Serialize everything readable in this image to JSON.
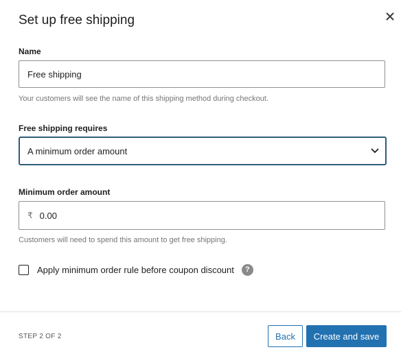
{
  "modal": {
    "title": "Set up free shipping",
    "close_icon": "close-icon"
  },
  "name_field": {
    "label": "Name",
    "value": "Free shipping",
    "help": "Your customers will see the name of this shipping method during checkout."
  },
  "requires_field": {
    "label": "Free shipping requires",
    "selected": "A minimum order amount",
    "icon": "chevron-down-icon"
  },
  "min_amount_field": {
    "label": "Minimum order amount",
    "currency_symbol": "₹",
    "value": "0.00",
    "help": "Customers will need to spend this amount to get free shipping."
  },
  "coupon_rule": {
    "label": "Apply minimum order rule before coupon discount",
    "checked": false,
    "help_icon": "help-icon",
    "help_glyph": "?"
  },
  "footer": {
    "step": "STEP 2 OF 2",
    "back_label": "Back",
    "primary_label": "Create and save"
  },
  "colors": {
    "primary": "#2271b1",
    "focus_border": "#2c5c78"
  }
}
